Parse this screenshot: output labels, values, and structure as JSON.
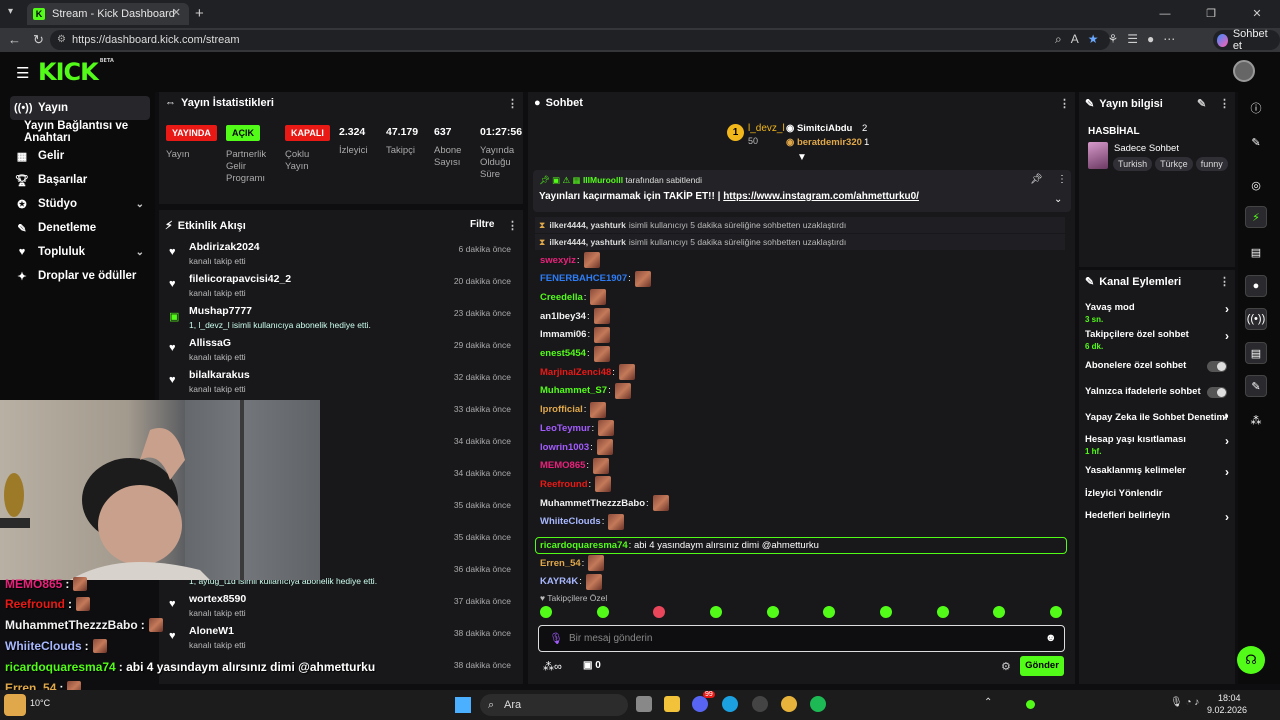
{
  "browser": {
    "tab_title": "Stream - Kick Dashboard",
    "tab_favicon": "K",
    "new_tab": "+",
    "url": "https://dashboard.kick.com/stream",
    "copilot_label": "Sohbet et",
    "window_controls": [
      "—",
      "❐",
      "✕"
    ],
    "nav": [
      "←",
      "↻"
    ]
  },
  "header": {
    "logo": "KICK",
    "logo_badge": "BETA"
  },
  "sidebar": {
    "items": [
      {
        "label": "Yayın",
        "icon": "broadcast-icon"
      },
      {
        "label": "Yayın Bağlantısı ve Anahtarı",
        "icon": ""
      },
      {
        "label": "Gelir",
        "icon": "revenue-icon"
      },
      {
        "label": "Başarılar",
        "icon": "trophy-icon"
      },
      {
        "label": "Stüdyo",
        "icon": "studio-icon"
      },
      {
        "label": "Denetleme",
        "icon": "wrench-icon"
      },
      {
        "label": "Topluluk",
        "icon": "community-icon"
      },
      {
        "label": "Droplar ve ödüller",
        "icon": "gift-icon"
      }
    ]
  },
  "stats": {
    "title": "Yayın İstatistikleri",
    "badges": [
      {
        "text": "YAYINDA",
        "label": "Yayın",
        "color": "#e91916"
      },
      {
        "text": "AÇIK",
        "label": "Partnerlik Gelir Programı",
        "color": "#53fc18"
      },
      {
        "text": "KAPALI",
        "label": "Çoklu Yayın",
        "color": "#e91916"
      }
    ],
    "numbers": [
      {
        "value": "2.324",
        "label": "İzleyici"
      },
      {
        "value": "47.179",
        "label": "Takipçi"
      },
      {
        "value": "637",
        "label": "Abone Sayısı"
      },
      {
        "value": "01:27:56",
        "label": "Yayında Olduğu Süre"
      }
    ]
  },
  "activity": {
    "title": "Etkinlik Akışı",
    "filter": "Filtre",
    "rows": [
      {
        "name": "Abdirizak2024",
        "sub": "kanalı takip etti",
        "time": "6 dakika önce",
        "icon": "heart-icon"
      },
      {
        "name": "filelicorapavcisi42_2",
        "sub": "kanalı takip etti",
        "time": "20 dakika önce",
        "icon": "heart-icon"
      },
      {
        "name": "Mushap7777",
        "sub": "1, l_devz_l isimli kullanıcıya abonelik hediye etti.",
        "time": "23 dakika önce",
        "icon": "gift-icon"
      },
      {
        "name": "AllissaG",
        "sub": "kanalı takip etti",
        "time": "29 dakika önce",
        "icon": "heart-icon"
      },
      {
        "name": "bilalkarakus",
        "sub": "kanalı takip etti",
        "time": "32 dakika önce",
        "icon": "heart-icon"
      },
      {
        "name": "",
        "sub": "hediye etti.",
        "time": "33 dakika önce",
        "icon": ""
      },
      {
        "name": "",
        "sub": "",
        "time": "34 dakika önce",
        "icon": ""
      },
      {
        "name": "",
        "sub": "hediye etti.",
        "time": "34 dakika önce",
        "icon": ""
      },
      {
        "name": "",
        "sub": "hediye etti.",
        "time": "35 dakika önce",
        "icon": ""
      },
      {
        "name": "",
        "sub": "",
        "time": "35 dakika önce",
        "icon": ""
      },
      {
        "name": "",
        "sub": "1, aytug_t1d isimli kullanıcıya abonelik hediye etti.",
        "time": "36 dakika önce",
        "icon": ""
      },
      {
        "name": "wortex8590",
        "sub": "kanalı takip etti",
        "time": "37 dakika önce",
        "icon": "heart-icon"
      },
      {
        "name": "AloneW1",
        "sub": "kanalı takip etti",
        "time": "38 dakika önce",
        "icon": "heart-icon"
      },
      {
        "name": "",
        "sub": "",
        "time": "38 dakika önce",
        "icon": ""
      }
    ]
  },
  "chat": {
    "title": "Sohbet",
    "leaderboard": [
      {
        "rank": "1",
        "name": "l_devz_l",
        "count": "50"
      },
      {
        "name": "SimitciAbdu",
        "count": "2"
      },
      {
        "name": "beratdemir320",
        "count": "1"
      }
    ],
    "pinned": {
      "by": "IIIMuroolll",
      "by_suffix": "tarafından sabitlendi",
      "message": "Yayınları kaçırmamak için TAKİP ET!! |",
      "link": "https://www.instagram.com/ahmetturku0/"
    },
    "system": [
      {
        "users": "ilker4444, yashturk",
        "text": "isimli kullanıcıyı 5 dakika süreliğine sohbetten uzaklaştırdı"
      },
      {
        "users": "ilker4444, yashturk",
        "text": "isimli kullanıcıyı 5 dakika süreliğine sohbetten uzaklaştırdı"
      }
    ],
    "messages": [
      {
        "user": "swexyiz",
        "color": "#e8227a",
        "text": ":"
      },
      {
        "user": "FENERBAHCE1907",
        "color": "#2e7df6",
        "text": ":"
      },
      {
        "user": "Creedella",
        "color": "#53fc18",
        "text": ":"
      },
      {
        "user": "an1lbey34",
        "color": "#f2f2f2",
        "text": ":"
      },
      {
        "user": "Immami06",
        "color": "#f2f2f2",
        "text": ":"
      },
      {
        "user": "enest5454",
        "color": "#53fc18",
        "text": ":"
      },
      {
        "user": "MarjinalZenci48",
        "color": "#e91916",
        "text": ":"
      },
      {
        "user": "Muhammet_S7",
        "color": "#53fc18",
        "text": ":"
      },
      {
        "user": "lprofficial",
        "color": "#e0a84a",
        "text": ":"
      },
      {
        "user": "LeoTeymur",
        "color": "#a35cff",
        "text": ":"
      },
      {
        "user": "lowrin1003",
        "color": "#a35cff",
        "text": ":"
      },
      {
        "user": "MEMO865",
        "color": "#e8227a",
        "text": ":"
      },
      {
        "user": "Reefround",
        "color": "#e91916",
        "text": ":"
      },
      {
        "user": "MuhammetThezzzBabo",
        "color": "#f2f2f2",
        "text": ":"
      },
      {
        "user": "WhiiteClouds",
        "color": "#a8b8ff",
        "text": ":"
      },
      {
        "user": "ricardoquaresma74",
        "color": "#53fc18",
        "text": ": abi 4 yasındaym alırsınız dimi @ahmetturku"
      },
      {
        "user": "Erren_54",
        "color": "#e0a84a",
        "text": ":"
      },
      {
        "user": "KAYR4K",
        "color": "#a8b8ff",
        "text": ":"
      }
    ],
    "followers_only": "Takipçilere Özel",
    "input_placeholder": "Bir mesaj gönderin",
    "points": "0",
    "send": "Gönder"
  },
  "info": {
    "title": "Yayın bilgisi",
    "stream_title": "HASBİHAL",
    "category": "Sadece Sohbet",
    "tags": [
      "Turkish",
      "Türkçe",
      "funny"
    ]
  },
  "channel_actions": {
    "title": "Kanal Eylemleri",
    "rows": [
      {
        "label": "Yavaş mod",
        "sub": "3 sn.",
        "control": "arrow"
      },
      {
        "label": "Takipçilere özel sohbet",
        "sub": "6 dk.",
        "control": "arrow"
      },
      {
        "label": "Abonelere özel sohbet",
        "sub": "",
        "control": "toggle"
      },
      {
        "label": "Yalnızca ifadelerle sohbet",
        "sub": "",
        "control": "toggle"
      },
      {
        "label": "Yapay Zeka ile Sohbet Denetimi",
        "sub": "",
        "control": "external"
      },
      {
        "label": "Hesap yaşı kısıtlaması",
        "sub": "1 hf.",
        "control": "arrow"
      },
      {
        "label": "Yasaklanmış kelimeler",
        "sub": "",
        "control": "arrow"
      },
      {
        "label": "İzleyici Yönlendir",
        "sub": "",
        "control": ""
      },
      {
        "label": "Hedefleri belirleyin",
        "sub": "",
        "control": "arrow"
      }
    ]
  },
  "overlay": {
    "lines": [
      {
        "user": "MEMO865",
        "color": "#e8227a",
        "text": ":"
      },
      {
        "user": "Reefround",
        "color": "#e91916",
        "text": ":"
      },
      {
        "user": "MuhammetThezzzBabo",
        "color": "#f2f2f2",
        "text": ":"
      },
      {
        "user": "WhiiteClouds",
        "color": "#a8b8ff",
        "text": ":"
      },
      {
        "user": "ricardoquaresma74",
        "color": "#53fc18",
        "text": ": abi 4 yasındaym alırsınız dimi @ahmetturku"
      },
      {
        "user": "Erren_54",
        "color": "#e0a84a",
        "text": ":"
      },
      {
        "user": "KAYR4K",
        "color": "#a8b8ff",
        "text": ":"
      }
    ]
  },
  "taskbar": {
    "search": "Ara",
    "weather": "10°C",
    "time": "18:04",
    "date": "9.02.2026",
    "badge": "99"
  }
}
